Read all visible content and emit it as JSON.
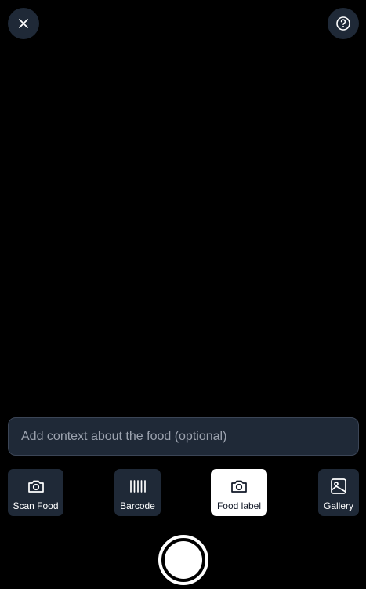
{
  "top_bar": {
    "close_icon": "x-icon",
    "help_icon": "question-circle-icon"
  },
  "context_input": {
    "value": "",
    "placeholder": "Add context about the food (optional)"
  },
  "modes": [
    {
      "label": "Scan Food",
      "icon": "camera-icon",
      "active": false
    },
    {
      "label": "Barcode",
      "icon": "barcode-icon",
      "active": false
    },
    {
      "label": "Food label",
      "icon": "camera-icon",
      "active": true
    },
    {
      "label": "Gallery",
      "icon": "image-icon",
      "active": false
    }
  ],
  "shutter": {
    "icon": "shutter-button"
  },
  "colors": {
    "background": "#000000",
    "surface": "#1f2937",
    "active_surface": "#ffffff",
    "text": "#ffffff",
    "placeholder": "#9ca3af"
  }
}
